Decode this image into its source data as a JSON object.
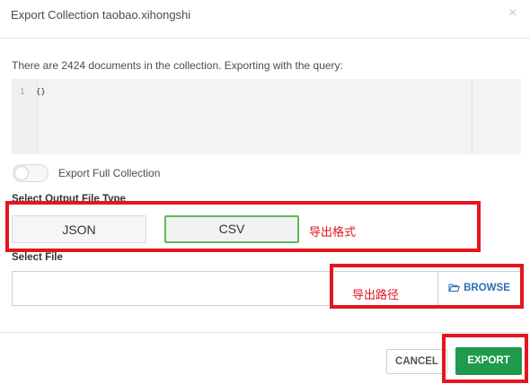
{
  "dialog": {
    "title": "Export Collection taobao.xihongshi",
    "close_icon": "×"
  },
  "query": {
    "info": "There are 2424 documents in the collection. Exporting with the query:",
    "editor": {
      "line_number": "1",
      "code": "{}"
    }
  },
  "full_collection": {
    "label": "Export Full Collection",
    "enabled": false
  },
  "output_type": {
    "label": "Select Output File Type",
    "options": [
      "JSON",
      "CSV"
    ],
    "selected": "CSV"
  },
  "select_file": {
    "label": "Select File",
    "value": "",
    "browse_label": "BROWSE",
    "browse_icon": "folder-open-icon"
  },
  "annotations": {
    "format_note": "导出格式",
    "path_note": "导出路径",
    "color": "#e4151f"
  },
  "footer": {
    "cancel_label": "CANCEL",
    "export_label": "EXPORT",
    "export_color": "#1f9b4d"
  }
}
